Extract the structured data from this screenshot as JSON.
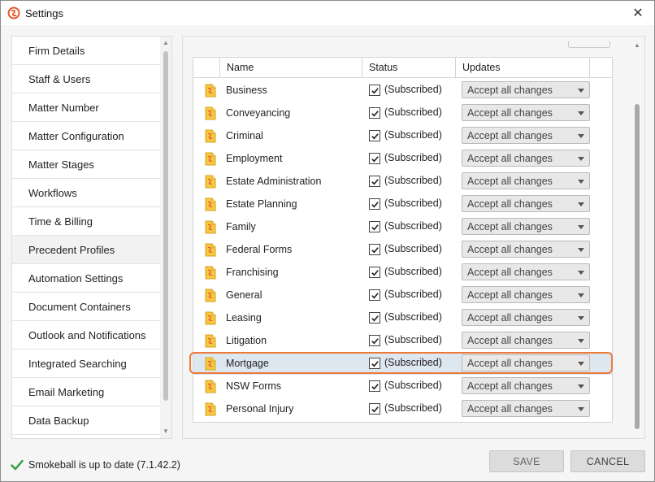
{
  "window": {
    "title": "Settings",
    "close_label": "✕"
  },
  "sidebar": {
    "items": [
      {
        "label": "Firm Details"
      },
      {
        "label": "Staff & Users"
      },
      {
        "label": "Matter Number"
      },
      {
        "label": "Matter Configuration"
      },
      {
        "label": "Matter Stages"
      },
      {
        "label": "Workflows"
      },
      {
        "label": "Time & Billing"
      },
      {
        "label": "Precedent Profiles",
        "active": true
      },
      {
        "label": "Automation Settings"
      },
      {
        "label": "Document Containers"
      },
      {
        "label": "Outlook and Notifications"
      },
      {
        "label": "Integrated Searching"
      },
      {
        "label": "Email Marketing"
      },
      {
        "label": "Data Backup"
      }
    ]
  },
  "grid": {
    "columns": {
      "name": "Name",
      "status": "Status",
      "updates": "Updates"
    },
    "rows": [
      {
        "name": "Business",
        "checked": true,
        "status": "(Subscribed)",
        "update": "Accept all changes"
      },
      {
        "name": "Conveyancing",
        "checked": true,
        "status": "(Subscribed)",
        "update": "Accept all changes"
      },
      {
        "name": "Criminal",
        "checked": true,
        "status": "(Subscribed)",
        "update": "Accept all changes"
      },
      {
        "name": "Employment",
        "checked": true,
        "status": "(Subscribed)",
        "update": "Accept all changes"
      },
      {
        "name": "Estate Administration",
        "checked": true,
        "status": "(Subscribed)",
        "update": "Accept all changes"
      },
      {
        "name": "Estate Planning",
        "checked": true,
        "status": "(Subscribed)",
        "update": "Accept all changes"
      },
      {
        "name": "Family",
        "checked": true,
        "status": "(Subscribed)",
        "update": "Accept all changes"
      },
      {
        "name": "Federal Forms",
        "checked": true,
        "status": "(Subscribed)",
        "update": "Accept all changes"
      },
      {
        "name": "Franchising",
        "checked": true,
        "status": "(Subscribed)",
        "update": "Accept all changes"
      },
      {
        "name": "General",
        "checked": true,
        "status": "(Subscribed)",
        "update": "Accept all changes"
      },
      {
        "name": "Leasing",
        "checked": true,
        "status": "(Subscribed)",
        "update": "Accept all changes"
      },
      {
        "name": "Litigation",
        "checked": true,
        "status": "(Subscribed)",
        "update": "Accept all changes"
      },
      {
        "name": "Mortgage",
        "checked": true,
        "status": "(Subscribed)",
        "update": "Accept all changes",
        "selected": true
      },
      {
        "name": "NSW Forms",
        "checked": true,
        "status": "(Subscribed)",
        "update": "Accept all changes"
      },
      {
        "name": "Personal Injury",
        "checked": true,
        "status": "(Subscribed)",
        "update": "Accept all changes"
      }
    ]
  },
  "footer": {
    "status_text": "Smokeball is up to date (7.1.42.2)",
    "save_label": "SAVE",
    "cancel_label": "CANCEL"
  },
  "colors": {
    "accent_orange": "#ee7a3a",
    "selected_row": "#dde7f0",
    "check_green": "#2e9e3e",
    "folder_yellow": "#f5c842"
  }
}
